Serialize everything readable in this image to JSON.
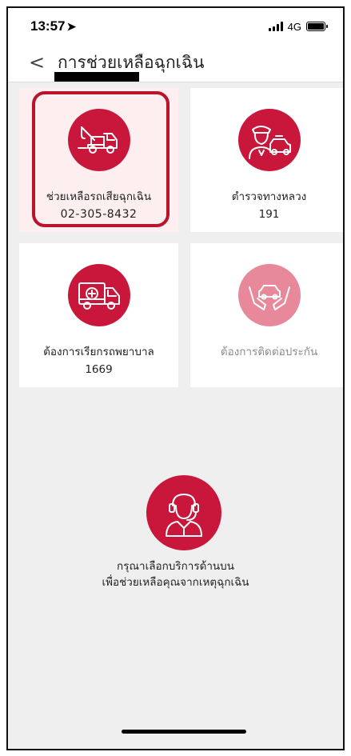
{
  "status_bar": {
    "time": "13:57",
    "network": "4G"
  },
  "nav": {
    "back": "<",
    "title": "การช่วยเหลือฉุกเฉิน"
  },
  "cards": [
    {
      "title": "ช่วยเหลือรถเสียฉุกเฉิน",
      "subtitle": "02-305-8432",
      "icon": "tow-truck-icon",
      "selected": true
    },
    {
      "title": "ตำรวจทางหลวง",
      "subtitle": "191",
      "icon": "police-officer-car-icon"
    },
    {
      "title": "ต้องการเรียกรถพยาบาล",
      "subtitle": "1669",
      "icon": "ambulance-icon"
    },
    {
      "title": "ต้องการติดต่อประกัน",
      "subtitle": "",
      "icon": "car-in-hands-icon",
      "disabled": true
    }
  ],
  "prompt": {
    "icon": "support-agent-headset-icon",
    "line1": "กรุณาเลือกบริการด้านบน",
    "line2": "เพื่อช่วยเหลือคุณจากเหตุฉุกเฉิน"
  },
  "colors": {
    "accent": "#c8173a",
    "accent_muted": "#e8899b",
    "selection_ring": "#b8142c",
    "selected_card_bg": "#fdeef0",
    "page_bg": "#efefef"
  }
}
